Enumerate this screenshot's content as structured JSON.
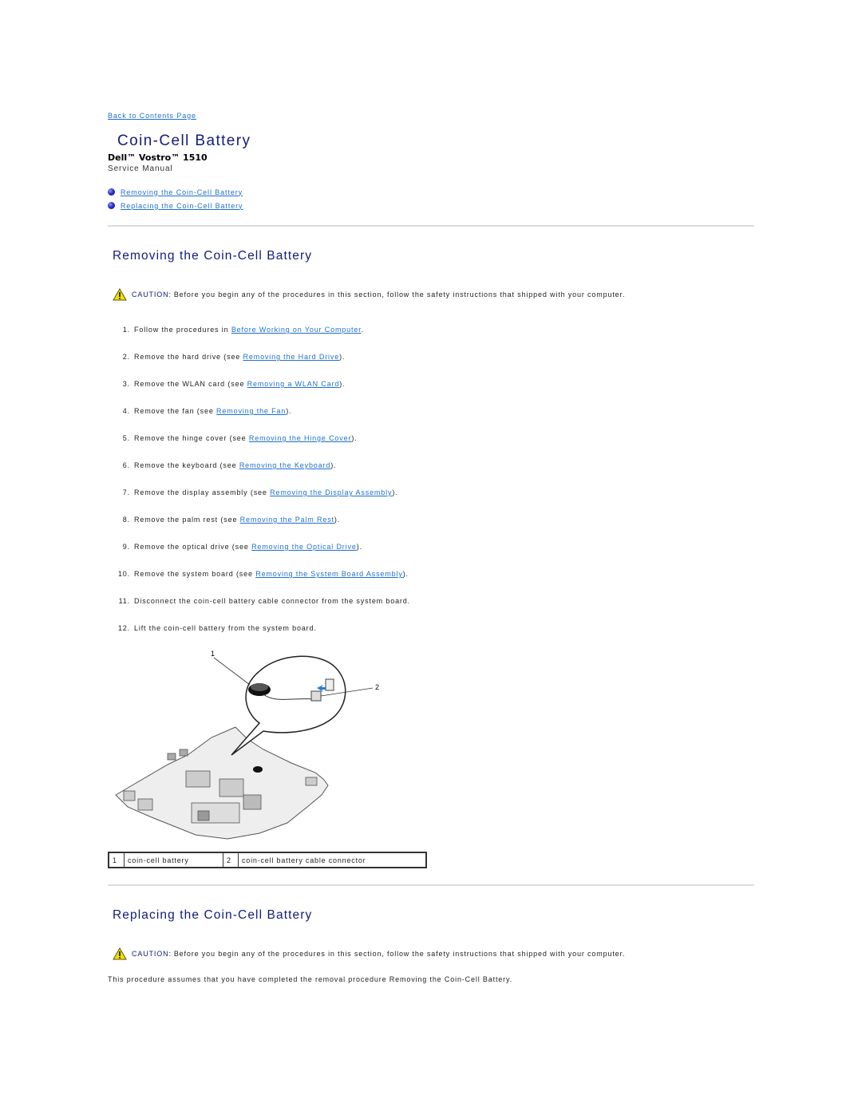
{
  "nav": {
    "back_link": "Back to Contents Page"
  },
  "header": {
    "title": "Coin-Cell Battery",
    "product": "Dell™ Vostro™ 1510",
    "subtitle": "Service Manual"
  },
  "toc": [
    {
      "label": "Removing the Coin-Cell Battery"
    },
    {
      "label": "Replacing the Coin-Cell Battery"
    }
  ],
  "removing": {
    "title": "Removing the Coin-Cell Battery",
    "caution_label": "CAUTION:",
    "caution_text": "Before you begin any of the procedures in this section, follow the safety instructions that shipped with your computer.",
    "steps": [
      {
        "num": "1.",
        "pre": "Follow the procedures in ",
        "link": "Before Working on Your Computer",
        "post": "."
      },
      {
        "num": "2.",
        "pre": "Remove the hard drive (see ",
        "link": "Removing the Hard Drive",
        "post": ")."
      },
      {
        "num": "3.",
        "pre": "Remove the WLAN card (see ",
        "link": "Removing a WLAN Card",
        "post": ")."
      },
      {
        "num": "4.",
        "pre": "Remove the fan (see ",
        "link": "Removing the Fan",
        "post": ")."
      },
      {
        "num": "5.",
        "pre": "Remove the hinge cover (see ",
        "link": "Removing the Hinge Cover",
        "post": ")."
      },
      {
        "num": "6.",
        "pre": "Remove the keyboard (see ",
        "link": "Removing the Keyboard",
        "post": ")."
      },
      {
        "num": "7.",
        "pre": "Remove the display assembly (see ",
        "link": "Removing the Display Assembly",
        "post": ")."
      },
      {
        "num": "8.",
        "pre": "Remove the palm rest (see ",
        "link": "Removing the Palm Rest",
        "post": ")."
      },
      {
        "num": "9.",
        "pre": "Remove the optical drive (see ",
        "link": "Removing the Optical Drive",
        "post": ")."
      },
      {
        "num": "10.",
        "pre": "Remove the system board (see ",
        "link": "Removing the System Board Assembly",
        "post": ")."
      },
      {
        "num": "11.",
        "pre": "Disconnect the coin-cell battery cable connector from the system board.",
        "link": "",
        "post": ""
      },
      {
        "num": "12.",
        "pre": "Lift the coin-cell battery from the system board.",
        "link": "",
        "post": ""
      }
    ],
    "figure": {
      "callout_1": "1",
      "callout_2": "2"
    },
    "legend": [
      {
        "num": "1",
        "label": "coin-cell battery"
      },
      {
        "num": "2",
        "label": "coin-cell battery cable connector"
      }
    ]
  },
  "replacing": {
    "title": "Replacing the Coin-Cell Battery",
    "caution_label": "CAUTION:",
    "caution_text": "Before you begin any of the procedures in this section, follow the safety instructions that shipped with your computer.",
    "paragraph": "This procedure assumes that you have completed the removal procedure Removing the Coin-Cell Battery."
  }
}
